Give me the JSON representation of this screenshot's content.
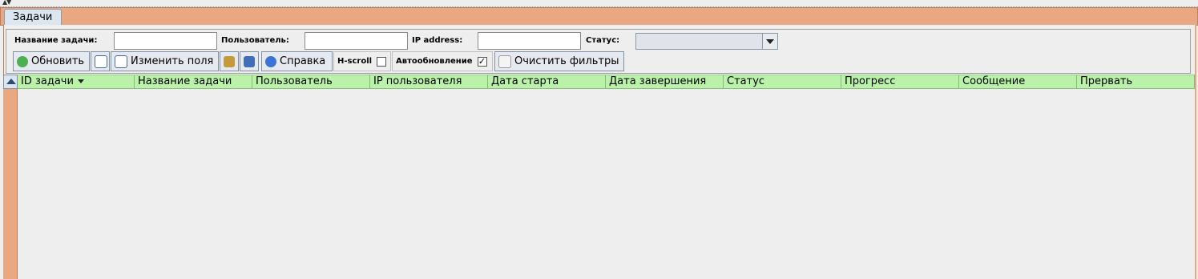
{
  "tab": {
    "label": "Задачи"
  },
  "filters": {
    "task_name_label": "Название задачи:",
    "task_name_value": "",
    "user_label": "Пользователь:",
    "user_value": "",
    "ip_label": "IP address:",
    "ip_value": "",
    "status_label": "Статус:",
    "status_value": ""
  },
  "toolbar": {
    "refresh": "Обновить",
    "edit_fields": "Изменить поля",
    "help": "Справка",
    "hscroll": "H-scroll",
    "hscroll_checked": false,
    "autorefresh": "Автообновление",
    "autorefresh_checked": true,
    "autorefresh_mark": "✓",
    "clear_filters": "Очистить фильтры"
  },
  "table": {
    "columns": [
      "ID задачи",
      "Название задачи",
      "Пользователь",
      "IP пользователя",
      "Дата старта",
      "Дата завершения",
      "Статус",
      "Прогресс",
      "Сообщение",
      "Прервать"
    ],
    "rows": []
  },
  "colors": {
    "accent": "#e9a882",
    "header": "#b9f2a8",
    "tab": "#dce6f0"
  },
  "icons": [
    "refresh-icon",
    "list-icon",
    "edit-fields-icon",
    "tools-icon",
    "save-icon",
    "help-icon",
    "clear-filters-icon",
    "collapse-icon",
    "sort-desc-icon",
    "dropdown-arrow-icon"
  ]
}
